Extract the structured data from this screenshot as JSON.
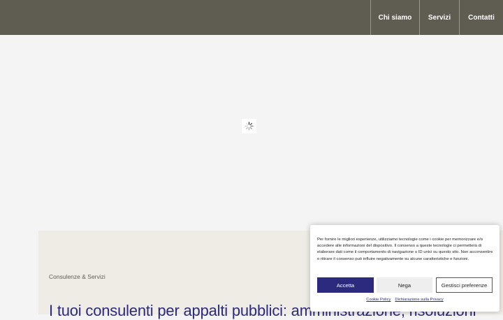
{
  "nav": {
    "items": [
      {
        "label": "Chi siamo"
      },
      {
        "label": "Servizi"
      },
      {
        "label": "Contatti"
      }
    ]
  },
  "hero": {
    "loader_icon": "spinner-icon"
  },
  "content": {
    "eyebrow": "Consulenze & Servizi",
    "headline": "I tuoi consulenti per appalti pubblici: amministrazione, risoluzioni"
  },
  "cookie_banner": {
    "text": "Per fornire le migliori esperienze, utilizziamo tecnologie come i cookie per memorizzare e/o accedere alle informazioni del dispositivo. Il consenso a queste tecnologie ci permetterà di elaborare dati come il comportamento di navigazione o ID unici su questo sito. Non acconsentire o ritirare il consenso può influire negativamente su alcune caratteristiche e funzioni.",
    "accept_label": "Accetta",
    "deny_label": "Nega",
    "preferences_label": "Gestisci preferenze",
    "links": [
      {
        "label": "Cookie Policy"
      },
      {
        "label": "Dichiarazione sulla Privacy"
      }
    ]
  },
  "colors": {
    "header_bg": "#5f5c51",
    "accent": "#2b2a7e",
    "content_bg": "#efece6"
  }
}
